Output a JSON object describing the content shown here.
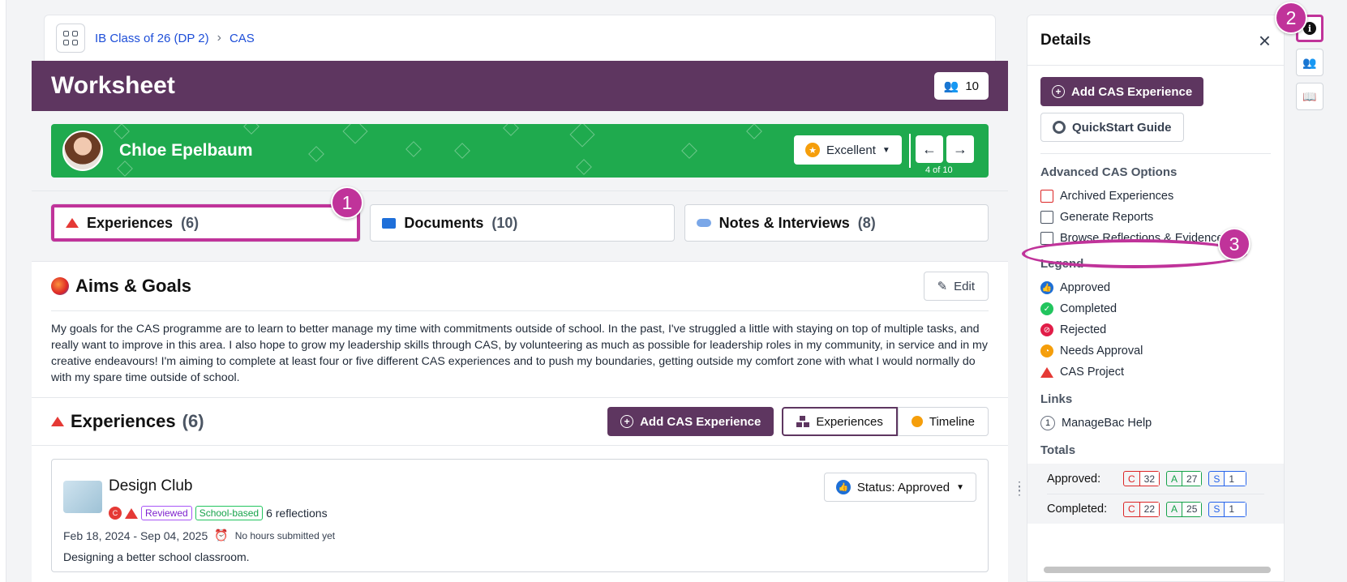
{
  "breadcrumb": {
    "items": [
      "IB Class of 26 (DP 2)",
      "CAS"
    ],
    "sep": "›"
  },
  "header": {
    "title": "Worksheet",
    "count": "10"
  },
  "student": {
    "name": "Chloe Epelbaum",
    "rating": "Excellent",
    "position": "4 of 10"
  },
  "tabs": [
    {
      "label": "Experiences",
      "count": "(6)"
    },
    {
      "label": "Documents",
      "count": "(10)"
    },
    {
      "label": "Notes & Interviews",
      "count": "(8)"
    }
  ],
  "aims": {
    "title": "Aims & Goals",
    "edit": "Edit",
    "text": "My goals for the CAS programme are to learn to better manage my time with commitments outside of school. In the past, I've struggled a little with staying on top of multiple tasks, and really want to improve in this area. I also hope to grow my leadership skills through CAS, by volunteering as much as possible for leadership roles in my community, in service and in my creative endeavours! I'm aiming to complete at least four or five different CAS experiences and to push my boundaries, getting outside my comfort zone with what I would normally do with my spare time outside of school."
  },
  "experiences": {
    "title": "Experiences",
    "count": "(6)",
    "add": "Add CAS Experience",
    "view_experiences": "Experiences",
    "view_timeline": "Timeline"
  },
  "card": {
    "title": "Design Club",
    "badge": "C",
    "tag_reviewed": "Reviewed",
    "tag_school": "School-based",
    "reflections": "6 reflections",
    "dates": "Feb 18, 2024 - Sep 04, 2025",
    "hours": "No hours submitted yet",
    "desc": "Designing a better school classroom.",
    "status": "Status: Approved"
  },
  "panel": {
    "title": "Details",
    "add": "Add CAS Experience",
    "guide": "QuickStart Guide",
    "advanced_title": "Advanced CAS Options",
    "advanced": [
      "Archived Experiences",
      "Generate Reports",
      "Browse Reflections & Evidence"
    ],
    "legend_title": "Legend",
    "legend": [
      "Approved",
      "Completed",
      "Rejected",
      "Needs Approval",
      "CAS Project"
    ],
    "links_title": "Links",
    "link_num": "1",
    "link": "ManageBac Help",
    "totals_title": "Totals",
    "totals": [
      {
        "label": "Approved:",
        "c": "C",
        "cv": "32",
        "a": "A",
        "av": "27",
        "s": "S",
        "sv": "1"
      },
      {
        "label": "Completed:",
        "c": "C",
        "cv": "22",
        "a": "A",
        "av": "25",
        "s": "S",
        "sv": "1"
      }
    ]
  },
  "callouts": [
    "1",
    "2",
    "3"
  ],
  "colors": {
    "brand": "#5e3660",
    "banner": "#1faa4e",
    "highlight": "#c0339a"
  }
}
